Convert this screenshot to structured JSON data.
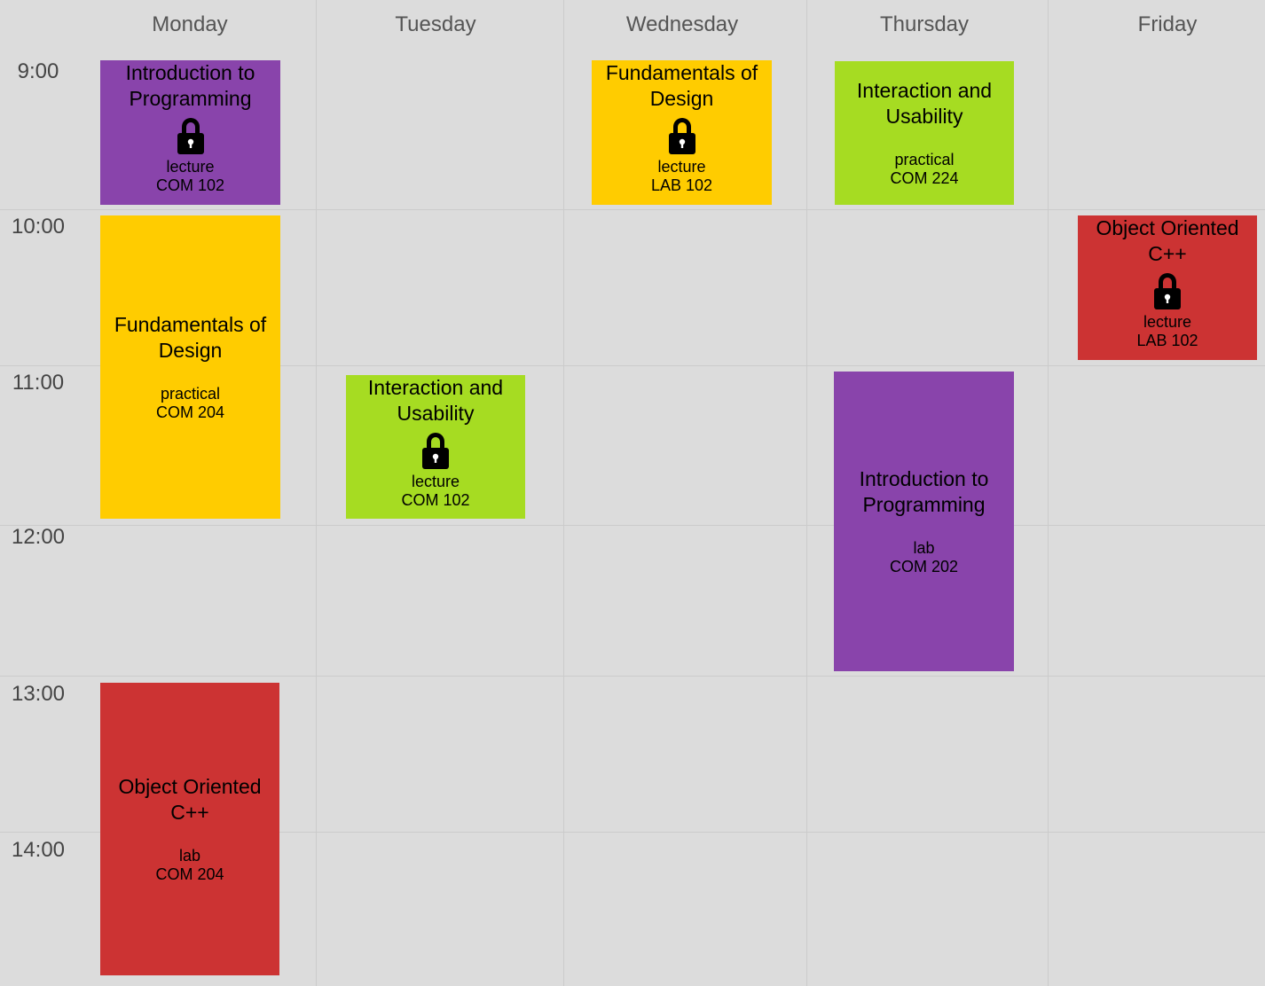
{
  "days": [
    "Monday",
    "Tuesday",
    "Wednesday",
    "Thursday",
    "Friday"
  ],
  "times": [
    "9:00",
    "10:00",
    "11:00",
    "12:00",
    "13:00",
    "14:00"
  ],
  "colors": {
    "purple": "#8944ab",
    "yellow": "#ffcc00",
    "green": "#a6dc22",
    "red": "#cc3333",
    "background": "#dcdcdc",
    "grid": "#cbcbcb"
  },
  "events": [
    {
      "title": "Introduction to Programming",
      "type": "lecture",
      "room": "COM 102",
      "locked": true,
      "color": "#8944ab",
      "day": "Monday",
      "start": "9:00"
    },
    {
      "title": "Fundamentals of Design",
      "type": "practical",
      "room": "COM 204",
      "locked": false,
      "color": "#ffcc00",
      "day": "Monday",
      "start": "10:00"
    },
    {
      "title": "Object Oriented C++",
      "type": "lab",
      "room": "COM 204",
      "locked": false,
      "color": "#cc3333",
      "day": "Monday",
      "start": "13:00"
    },
    {
      "title": "Interaction and Usability",
      "type": "lecture",
      "room": "COM 102",
      "locked": true,
      "color": "#a6dc22",
      "day": "Tuesday",
      "start": "11:00"
    },
    {
      "title": "Fundamentals of Design",
      "type": "lecture",
      "room": "LAB 102",
      "locked": true,
      "color": "#ffcc00",
      "day": "Wednesday",
      "start": "9:00"
    },
    {
      "title": "Interaction and Usability",
      "type": "practical",
      "room": "COM 224",
      "locked": false,
      "color": "#a6dc22",
      "day": "Thursday",
      "start": "9:00"
    },
    {
      "title": "Introduction to Programming",
      "type": "lab",
      "room": "COM 202",
      "locked": false,
      "color": "#8944ab",
      "day": "Thursday",
      "start": "11:00"
    },
    {
      "title": "Object Oriented C++",
      "type": "lecture",
      "room": "LAB 102",
      "locked": true,
      "color": "#cc3333",
      "day": "Friday",
      "start": "10:00"
    }
  ]
}
